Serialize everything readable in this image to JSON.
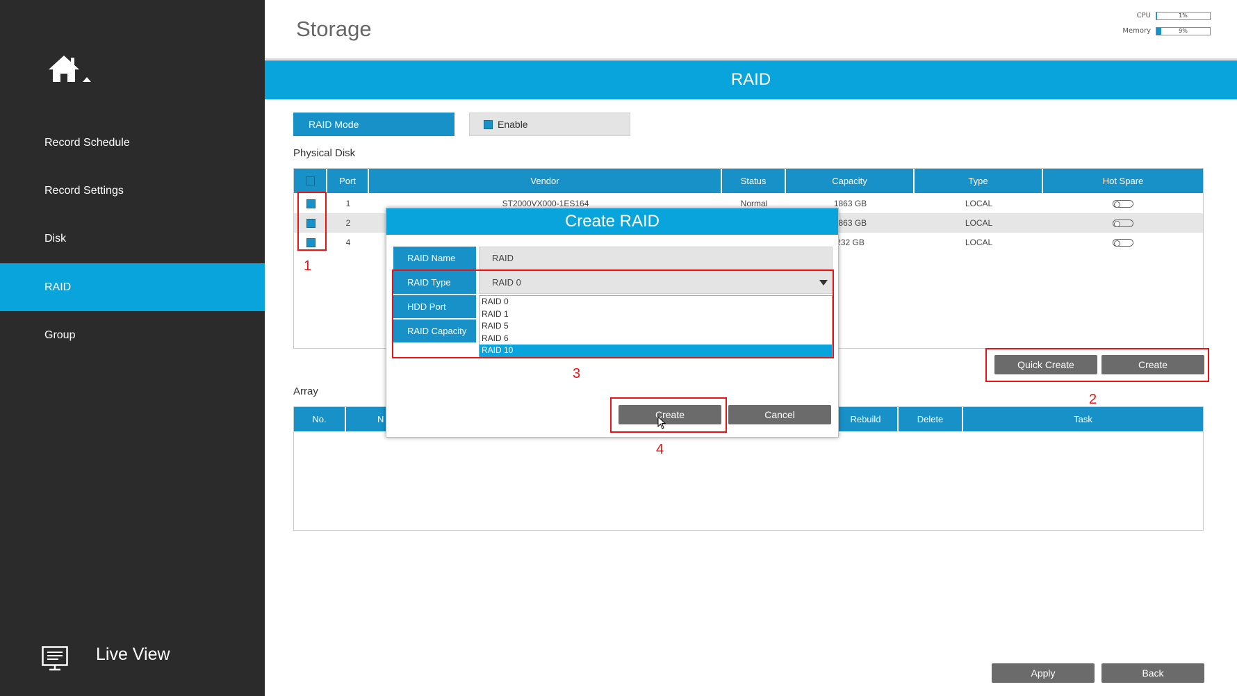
{
  "sidebar": {
    "items": [
      {
        "label": "Record Schedule",
        "active": false
      },
      {
        "label": "Record Settings",
        "active": false
      },
      {
        "label": "Disk",
        "active": false
      },
      {
        "label": "RAID",
        "active": true
      },
      {
        "label": "Group",
        "active": false
      }
    ],
    "live_view_label": "Live View"
  },
  "header": {
    "title": "Storage",
    "cpu_label": "CPU",
    "cpu_value": "1%",
    "cpu_percent": 1,
    "memory_label": "Memory",
    "memory_value": "9%",
    "memory_percent": 9
  },
  "banner": {
    "title": "RAID"
  },
  "raid_mode": {
    "label": "RAID Mode",
    "enable_label": "Enable",
    "enabled": true
  },
  "physical_disk": {
    "section_label": "Physical Disk",
    "columns": [
      "Port",
      "Vendor",
      "Status",
      "Capacity",
      "Type",
      "Hot Spare"
    ],
    "rows": [
      {
        "port": "1",
        "vendor": "ST2000VX000-1ES164",
        "status": "Normal",
        "capacity": "1863 GB",
        "type": "LOCAL",
        "checked": true
      },
      {
        "port": "2",
        "vendor": "",
        "status": "",
        "capacity": "1863 GB",
        "type": "LOCAL",
        "checked": true
      },
      {
        "port": "4",
        "vendor": "",
        "status": "",
        "capacity": "232 GB",
        "type": "LOCAL",
        "checked": true
      }
    ],
    "quick_create_label": "Quick Create",
    "create_label": "Create"
  },
  "array": {
    "section_label": "Array",
    "col_no": "No.",
    "col_n_partial": "N",
    "col_rebuild": "Rebuild",
    "col_delete": "Delete",
    "col_task": "Task"
  },
  "dialog": {
    "title": "Create RAID",
    "raid_name_label": "RAID Name",
    "raid_name_value": "RAID",
    "raid_type_label": "RAID Type",
    "raid_type_value": "RAID 0",
    "hdd_port_label": "HDD Port",
    "raid_capacity_label": "RAID Capacity",
    "raid_type_options": [
      "RAID 0",
      "RAID 1",
      "RAID 5",
      "RAID 6",
      "RAID 10"
    ],
    "highlighted_option": "RAID 10",
    "create_label": "Create",
    "cancel_label": "Cancel"
  },
  "annotations": [
    "1",
    "2",
    "3",
    "4"
  ],
  "footer": {
    "apply_label": "Apply",
    "back_label": "Back"
  },
  "colors": {
    "accent": "#0aa4dc",
    "accent_dark": "#1791c8",
    "sidebar_bg": "#2b2b2b",
    "button_gray": "#6b6b6b",
    "annotation_red": "#ee1111"
  }
}
